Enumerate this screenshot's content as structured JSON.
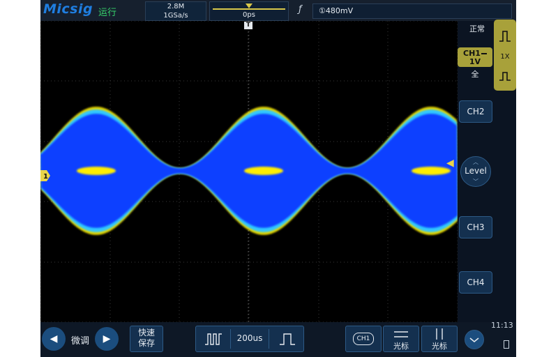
{
  "header": {
    "brand": "Micsig",
    "run_state": "运行",
    "memory_depth": "2.8M",
    "sample_rate": "1GSa/s",
    "trigger_position": "0ps",
    "trigger_level": "①480mV"
  },
  "plot": {
    "trigger_marker": "T",
    "ch1_marker": "1",
    "colors": {
      "envelope_inner": "#0a3fff",
      "envelope_edge": "#31c8ff",
      "envelope_glow": "#ffee00",
      "grid": "#3a3a3a"
    }
  },
  "right_panel": {
    "status": "正常",
    "ch1": {
      "label": "CH1",
      "scale": "1V",
      "coupling": "全"
    },
    "probe": {
      "ratio": "1X"
    },
    "ch2": "CH2",
    "level": "Level",
    "ch3": "CH3",
    "ch4": "CH4"
  },
  "bottom": {
    "fine_tune": "微调",
    "quick_save_line1": "快速",
    "quick_save_line2": "保存",
    "timebase": "200us",
    "channel_chip": "CH1",
    "cursor_h": "光标",
    "cursor_v": "光标",
    "clock": "11:13"
  }
}
